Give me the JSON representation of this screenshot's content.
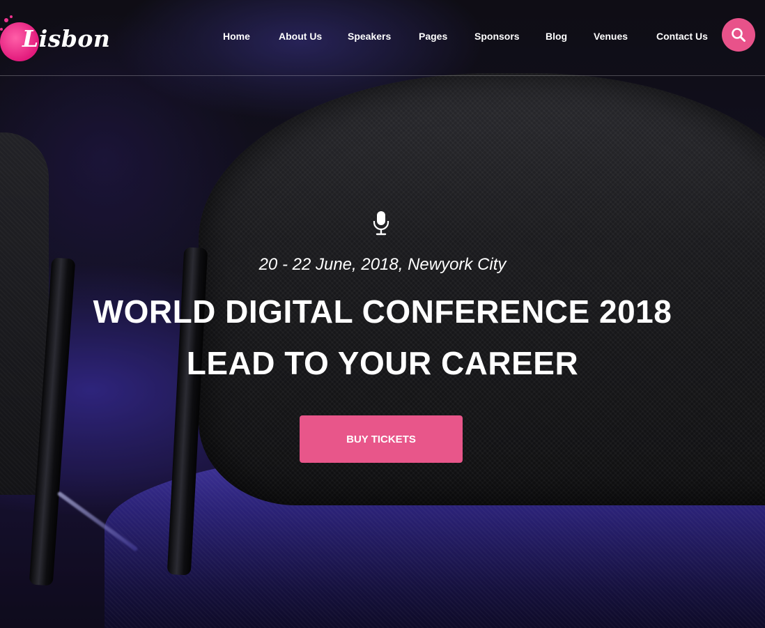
{
  "brand": {
    "name": "Lisbon",
    "accent_color": "#e8568a"
  },
  "nav": {
    "items": [
      {
        "label": "Home"
      },
      {
        "label": "About Us"
      },
      {
        "label": "Speakers"
      },
      {
        "label": "Pages"
      },
      {
        "label": "Sponsors"
      },
      {
        "label": "Blog"
      },
      {
        "label": "Venues"
      },
      {
        "label": "Contact Us"
      }
    ],
    "search_icon": "search-icon"
  },
  "hero": {
    "icon": "microphone-icon",
    "date_location": "20 - 22 June, 2018, Newyork City",
    "title_line1": "WORLD DIGITAL CONFERENCE 2018",
    "title_line2": "LEAD TO YOUR CAREER",
    "cta_label": "BUY TICKETS"
  }
}
